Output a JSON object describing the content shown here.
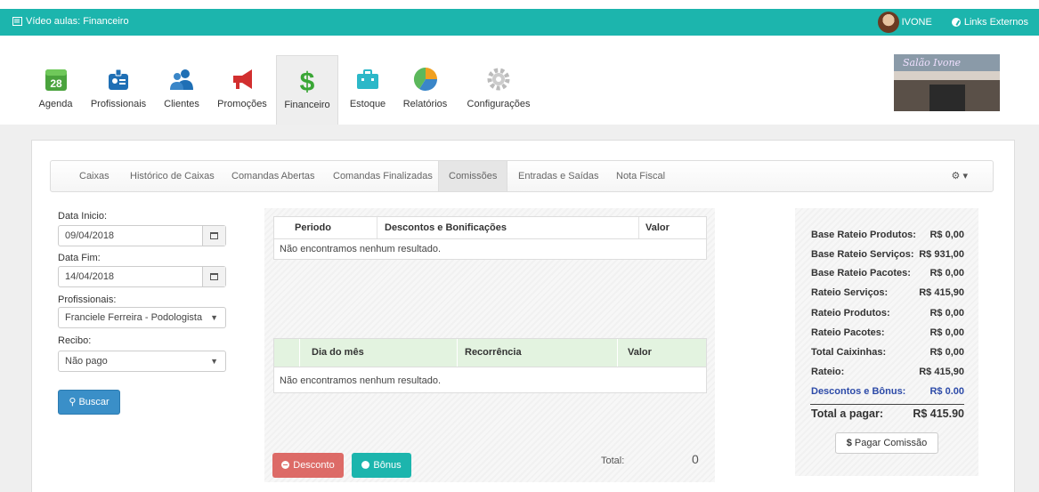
{
  "topbar": {
    "video_label": "Vídeo aulas: Financeiro",
    "user_name": "IVONE",
    "links_label": "Links Externos"
  },
  "nav": {
    "items": [
      {
        "label": "Agenda",
        "icon": "calendar-icon",
        "badge": "28"
      },
      {
        "label": "Profissionais",
        "icon": "id-card-icon"
      },
      {
        "label": "Clientes",
        "icon": "users-icon"
      },
      {
        "label": "Promoções",
        "icon": "megaphone-icon"
      },
      {
        "label": "Financeiro",
        "icon": "dollar-icon"
      },
      {
        "label": "Estoque",
        "icon": "briefcase-icon"
      },
      {
        "label": "Relatórios",
        "icon": "pie-chart-icon"
      },
      {
        "label": "Configurações",
        "icon": "cog-icon"
      }
    ],
    "active": "Financeiro",
    "logo_text": "Salão Ivone"
  },
  "tabs": [
    {
      "label": "Caixas"
    },
    {
      "label": "Histórico de Caixas"
    },
    {
      "label": "Comandas Abertas"
    },
    {
      "label": "Comandas Finalizadas"
    },
    {
      "label": "Comissões"
    },
    {
      "label": "Entradas e Saídas"
    },
    {
      "label": "Nota Fiscal"
    }
  ],
  "filters": {
    "data_inicio_label": "Data Inicio:",
    "data_inicio_value": "09/04/2018",
    "data_fim_label": "Data Fim:",
    "data_fim_value": "14/04/2018",
    "profissionais_label": "Profissionais:",
    "profissionais_value": "Franciele Ferreira - Podologista",
    "recibo_label": "Recibo:",
    "recibo_value": "Não pago",
    "buscar_label": "Buscar"
  },
  "table1": {
    "headers": [
      "Periodo",
      "Descontos e Bonificações",
      "Valor"
    ],
    "empty": "Não encontramos nenhum resultado."
  },
  "table2": {
    "headers": [
      "Dia do mês",
      "Recorrência",
      "Valor"
    ],
    "empty": "Não encontramos nenhum resultado."
  },
  "actions": {
    "desconto_label": "Desconto",
    "bonus_label": "Bônus",
    "total_label": "Total:",
    "total_value": "0"
  },
  "summary": {
    "rows": [
      {
        "label": "Base Rateio Produtos:",
        "value": "R$ 0,00"
      },
      {
        "label": "Base Rateio Serviços:",
        "value": "R$ 931,00"
      },
      {
        "label": "Base Rateio Pacotes:",
        "value": "R$ 0,00"
      },
      {
        "label": "Rateio Serviços:",
        "value": "R$ 415,90"
      },
      {
        "label": "Rateio Produtos:",
        "value": "R$ 0,00"
      },
      {
        "label": "Rateio Pacotes:",
        "value": "R$ 0,00"
      },
      {
        "label": "Total Caixinhas:",
        "value": "R$ 0,00"
      },
      {
        "label": "Rateio:",
        "value": "R$ 415,90"
      },
      {
        "label": "Descontos e Bônus:",
        "value": "R$ 0.00"
      }
    ],
    "total_label": "Total a pagar:",
    "total_value": "R$ 415.90",
    "pagar_label": "Pagar Comissão"
  },
  "colors": {
    "accent": "#1cb5ad",
    "primary_button": "#3a8fc8",
    "danger": "#d9534f",
    "discount_text": "#2c4aa8"
  }
}
